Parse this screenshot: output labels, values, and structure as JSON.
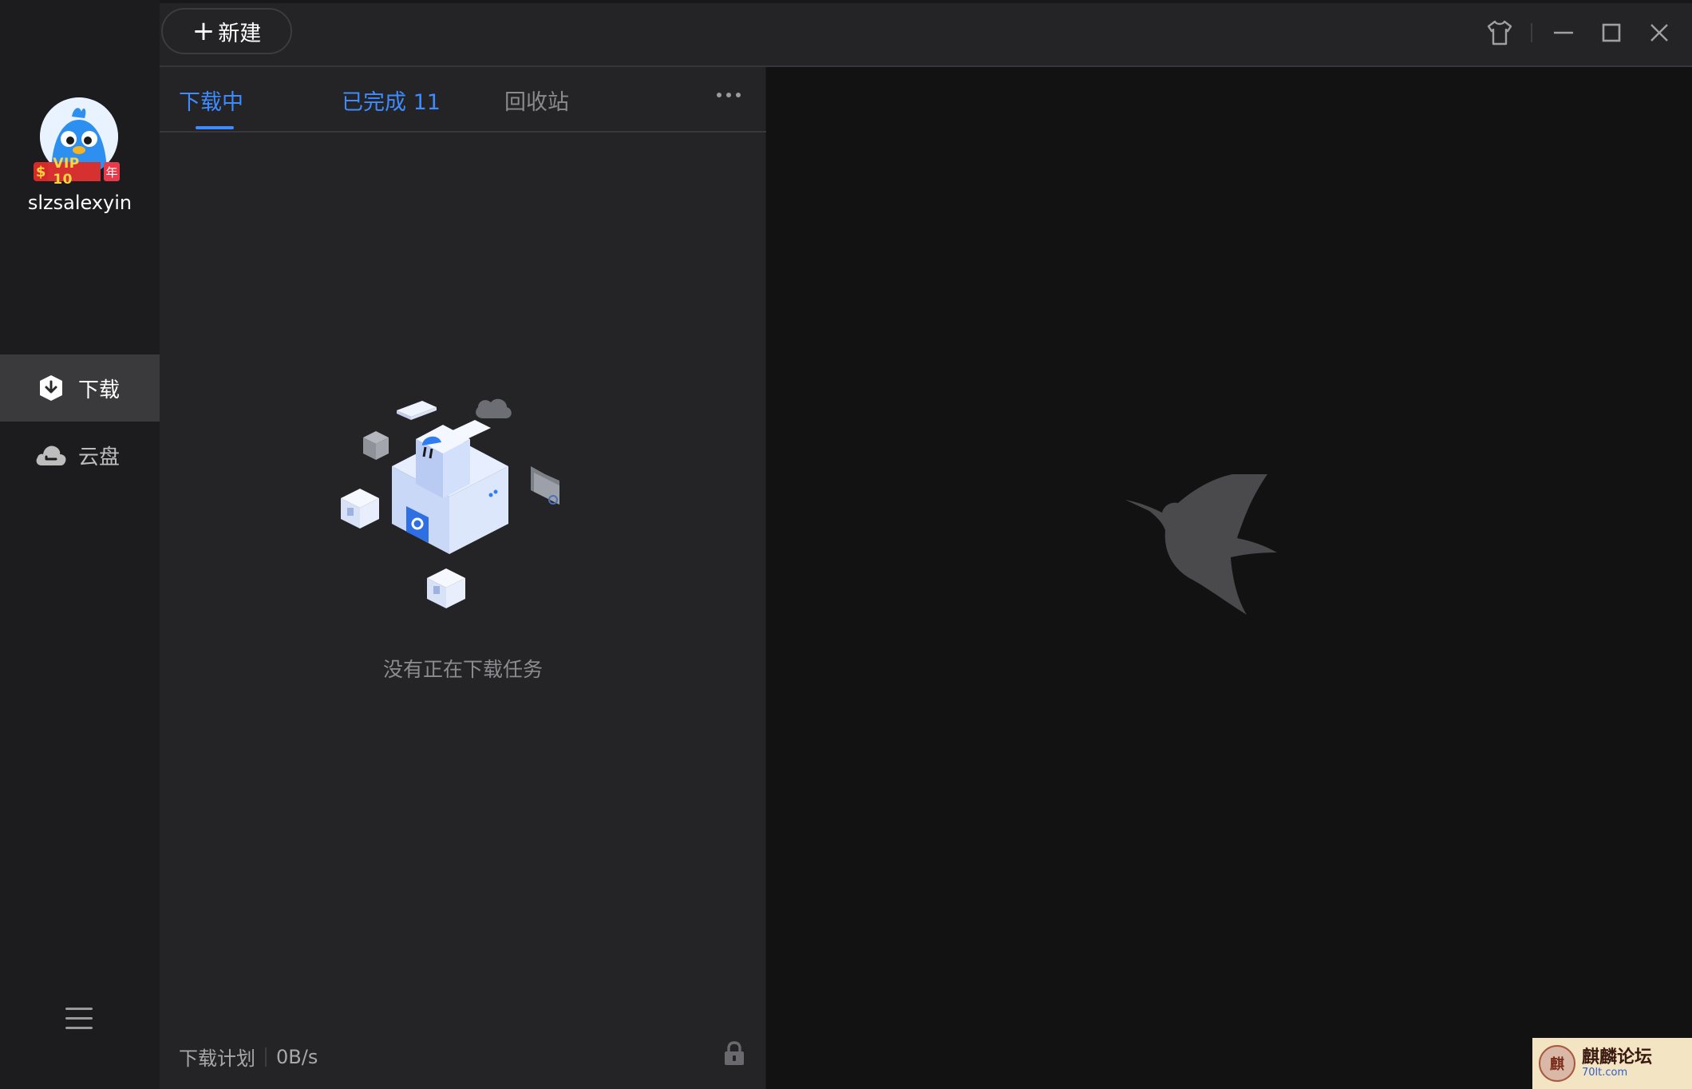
{
  "sidebar": {
    "username": "slzsalexyin",
    "vip": {
      "symbol": "$",
      "label": "VIP 10",
      "year": "年"
    },
    "nav": [
      {
        "label": "下载",
        "icon": "download-shield-icon",
        "active": true
      },
      {
        "label": "云盘",
        "icon": "cloud-icon",
        "active": false
      }
    ],
    "menu_icon": "hamburger-menu-icon"
  },
  "toolbar": {
    "new_label": "新建",
    "plus": "+",
    "controls": [
      "skin-icon",
      "minimize-icon",
      "maximize-icon",
      "close-icon"
    ]
  },
  "tabs": [
    {
      "label": "下载中",
      "active": true
    },
    {
      "label": "已完成 11",
      "active": false
    },
    {
      "label": "回收站",
      "active": false
    }
  ],
  "empty_state": {
    "message": "没有正在下载任务"
  },
  "footer": {
    "plan_label": "下载计划",
    "speed": "0B/s"
  },
  "watermark": {
    "logo_char": "麒",
    "title": "麒麟论坛",
    "sub": "70lt.com"
  },
  "colors": {
    "accent": "#3d8bff",
    "sidebar_bg": "#1c1c1e",
    "panel_bg": "#242427",
    "main_bg": "#121213",
    "vip_red": "#d63030",
    "vip_gold": "#ffd640"
  }
}
